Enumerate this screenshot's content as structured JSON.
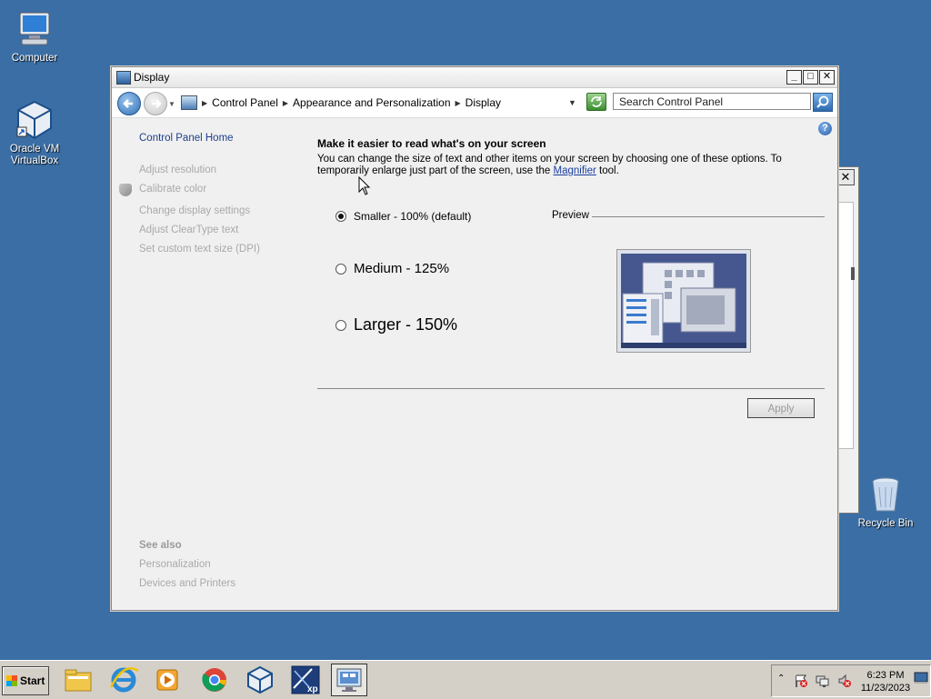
{
  "desktop": {
    "icons": [
      {
        "label": "Computer"
      },
      {
        "label": "Oracle VM\nVirtualBox"
      },
      {
        "label": "Recycle Bin"
      }
    ]
  },
  "window": {
    "title": "Display",
    "minimize": "_",
    "maximize": "□",
    "close": "✕",
    "breadcrumb": [
      "Control Panel",
      "Appearance and Personalization",
      "Display"
    ],
    "search_placeholder": "Search Control Panel",
    "help_label": "?"
  },
  "leftnav": {
    "home": "Control Panel Home",
    "links": [
      "Adjust resolution",
      "Calibrate color",
      "Change display settings",
      "Adjust ClearType text",
      "Set custom text size (DPI)"
    ],
    "see_also": "See also",
    "see_also_links": [
      "Personalization",
      "Devices and Printers"
    ]
  },
  "content": {
    "heading": "Make it easier to read what's on your screen",
    "description_pre": "You can change the size of text and other items on your screen by choosing one of these options. To temporarily enlarge just part of the screen, use the ",
    "description_link": "Magnifier",
    "description_post": " tool.",
    "options": [
      {
        "label": "Smaller - 100% (default)",
        "selected": true
      },
      {
        "label": "Medium - 125%",
        "selected": false
      },
      {
        "label": "Larger - 150%",
        "selected": false
      }
    ],
    "preview_label": "Preview",
    "apply_label": "Apply"
  },
  "taskbar": {
    "start_label": "Start",
    "apps": [
      "file-explorer-icon",
      "internet-explorer-icon",
      "media-player-icon",
      "chrome-icon",
      "virtualbox-icon",
      "xp-mode-icon",
      "display-settings-icon"
    ],
    "time": "6:23 PM",
    "date": "11/23/2023"
  },
  "colors": {
    "desktop": "#3a6ea5",
    "link": "#1d3f8a",
    "disabled": "#a9a9a9"
  }
}
